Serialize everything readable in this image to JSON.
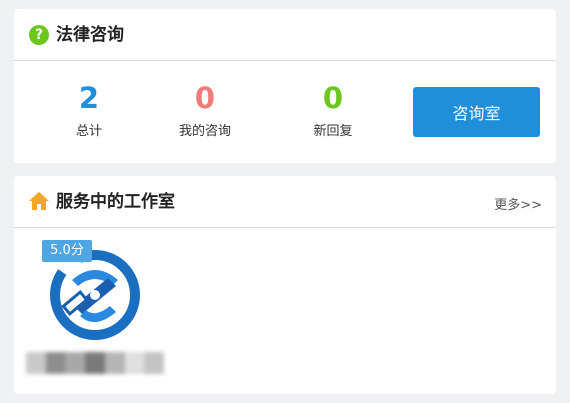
{
  "consult": {
    "title": "法律咨询",
    "help_glyph": "?",
    "help_icon_color": "#6cc61c",
    "stats": [
      {
        "value": "2",
        "label": "总计",
        "color": "#1e8fd8"
      },
      {
        "value": "0",
        "label": "我的咨询",
        "color": "#f07b7b"
      },
      {
        "value": "0",
        "label": "新回复",
        "color": "#6cc61c"
      }
    ],
    "button_label": "咨询室",
    "button_color": "#1e8fd8"
  },
  "studios": {
    "title": "服务中的工作室",
    "title_icon": "home-icon",
    "more_label": "更多>>",
    "items": [
      {
        "score": "5.0分",
        "logo_icon": "law-firm-logo"
      }
    ]
  }
}
